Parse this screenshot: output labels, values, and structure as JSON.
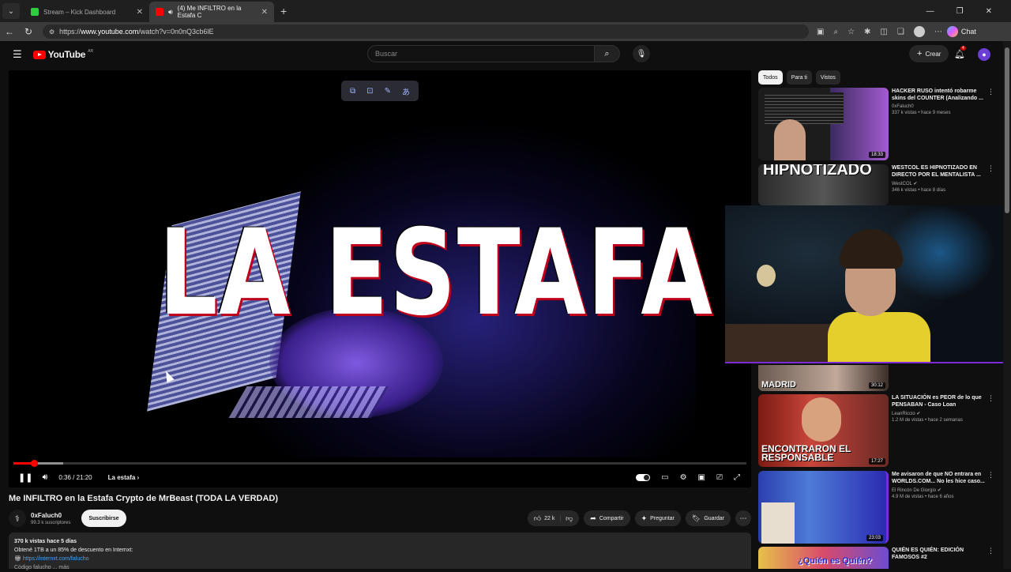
{
  "browser": {
    "tabs": [
      {
        "label": "Stream – Kick Dashboard",
        "active": false
      },
      {
        "label": "(4) Me INFILTRO en la Estafa C",
        "active": true
      }
    ],
    "url_prefix": "https://",
    "url_host": "www.youtube.com",
    "url_path": "/watch?v=0n0nQ3cb6lE",
    "chat_label": "Chat"
  },
  "header": {
    "logo_text": "YouTube",
    "logo_region": "AR",
    "search_placeholder": "Buscar",
    "create_label": "Crear",
    "notifications_count": "4"
  },
  "player": {
    "headline": "LA ESTAFA",
    "time": "0:36 / 21:20",
    "chapter": "La estafa",
    "played_fraction": 0.028,
    "buffered_fraction": 0.068
  },
  "video": {
    "title": "Me INFILTRO en la Estafa Crypto de MrBeast (TODA LA VERDAD)",
    "channel": "0xFaluch0",
    "subscribers": "99.3 k suscriptores",
    "subscribe_label": "Suscribirse",
    "likes": "22 k",
    "share_label": "Compartir",
    "ask_label": "Preguntar",
    "save_label": "Guardar",
    "description": {
      "meta": "370 k vistas  hace 5 días",
      "line1": "Obtené 1TB a un 85% de descuento en Internxt:",
      "link": "https://internxt.com/falucho",
      "line3": "Código falucho ... más"
    }
  },
  "filters": [
    "Todos",
    "Para ti",
    "Vistos"
  ],
  "recommendations": [
    {
      "title": "HACKER RUSO intentó robarme skins del COUNTER (Analizando ...",
      "channel": "0xFaluch0",
      "meta": "337 k vistas • hace 9 meses",
      "duration": "18:33",
      "caption": ""
    },
    {
      "title": "WESTCOL ES HIPNOTIZADO EN DIRECTO POR EL MENTALISTA ...",
      "channel": "WestCOL",
      "meta": "346 k vistas • hace 8 días",
      "duration": "",
      "caption": "HIPNOTIZADO"
    },
    {
      "title": "",
      "channel": "",
      "meta": "",
      "duration": "30:12",
      "caption": "MADRID"
    },
    {
      "title": "LA SITUACIÓN es PEOR de lo que PENSABAN - Caso Loan",
      "channel": "LeanRiccio",
      "meta": "1.2 M de vistas • hace 2 semanas",
      "duration": "17:27",
      "caption": "ENCONTRARON EL RESPONSABLE"
    },
    {
      "title": "Me avisaron de que NO entrara en WORLDS.COM... No les hice caso...",
      "channel": "El Rincón De Giorgio",
      "meta": "4.9 M de vistas • hace 6 años",
      "duration": "23:03",
      "caption": ""
    },
    {
      "title": "QUIÉN ES QUIÉN: EDICIÓN FAMOSOS #2",
      "channel": "",
      "meta": "",
      "duration": "",
      "caption": "¿Quién es Quién?"
    }
  ],
  "colors": {
    "accent_red": "#ff0000",
    "background": "#0f0f0f",
    "webcam_border": "#7d2bd9"
  }
}
